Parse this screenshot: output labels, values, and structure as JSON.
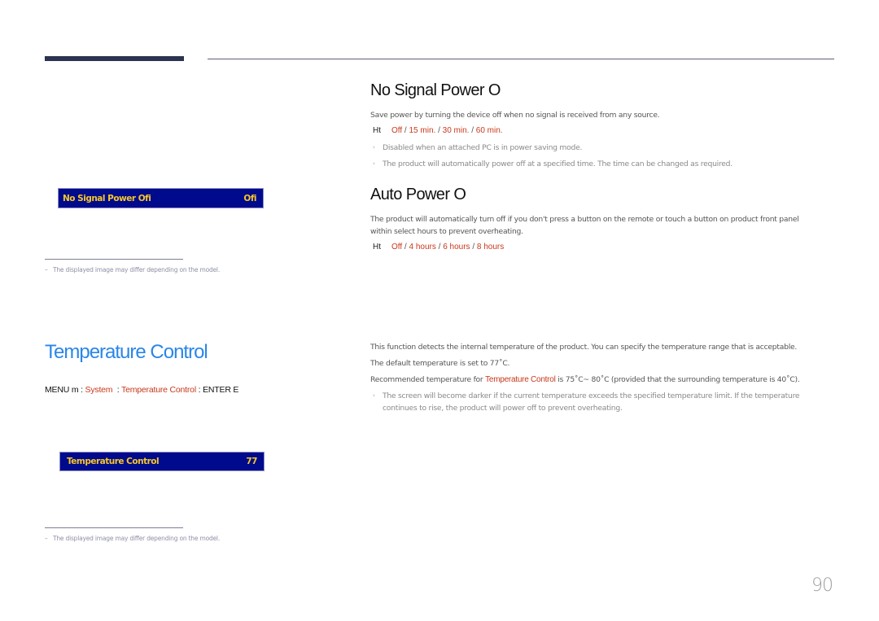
{
  "header": {
    "decor": "top-rule"
  },
  "no_signal_section": {
    "title": "No Signal Power O",
    "description": "Save power by turning the device off when no signal is received from any source.",
    "options_prefix": "Ht",
    "options": [
      "Off",
      "15 min.",
      "30 min.",
      "60 min."
    ],
    "notes": [
      "Disabled when an attached PC is in power saving mode.",
      "The product will automatically power off at a specified time. The time can be changed as required."
    ]
  },
  "auto_power_section": {
    "title": "Auto Power O",
    "description_line1": "The product will automatically turn off if you don't press a button on the remote or touch a button on product front panel",
    "description_line2": "within select hours to prevent overheating.",
    "options_prefix": "Ht",
    "options": [
      "Off",
      "4 hours",
      "6 hours",
      "8 hours"
    ]
  },
  "osd_no_signal": {
    "label": "No Signal Power Ofi",
    "value": "Ofi"
  },
  "footnote_top": {
    "dash": "–",
    "text": "The displayed image may differ depending on the model."
  },
  "temperature_section": {
    "title": "Temperature Control",
    "menu_path": {
      "menu": "MENU m",
      "sep1": " : ",
      "system": "System",
      "sep2": "  : ",
      "item": "Temperature Control",
      "sep3": " : ",
      "enter": "ENTER E"
    },
    "osd": {
      "label": "Temperature Control",
      "value": "77"
    },
    "para1": "This function detects the internal temperature of the product. You can specify the temperature range that is acceptable.",
    "para2": "The default temperature is set to 77˚C.",
    "para3_prefix": "Recommended temperature for ",
    "para3_highlight": "Temperature Control",
    "para3_suffix": " is 75˚C~ 80˚C (provided that the surrounding temperature is 40˚C).",
    "note_line1": "The screen will become darker if the current temperature exceeds the specified temperature limit. If the temperature",
    "note_line2": "continues to rise, the product will power off to prevent overheating."
  },
  "footnote_bottom": {
    "dash": "–",
    "text": "The displayed image may differ depending on the model."
  },
  "page_number": "90",
  "colors": {
    "accent_blue": "#2a86e8",
    "option_red": "#c9381c",
    "osd_bg": "#000a8c",
    "osd_text": "#f7c72a",
    "rule_dark": "#2b3350"
  }
}
